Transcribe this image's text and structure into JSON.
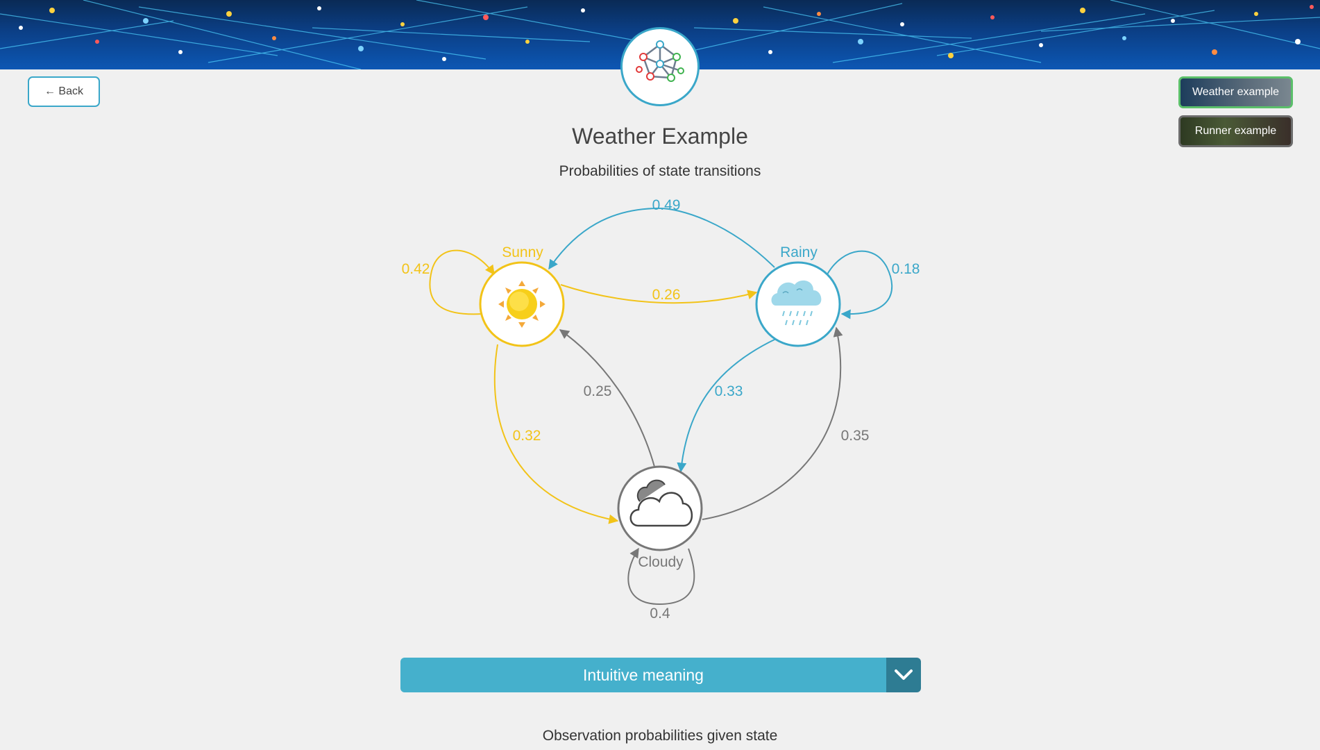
{
  "nav": {
    "back_label": "← Back"
  },
  "examples": {
    "weather_label": "Weather example",
    "runner_label": "Runner example"
  },
  "header": {
    "title": "Weather Example",
    "subtitle": "Probabilities of state transitions"
  },
  "diagram": {
    "states": {
      "sunny": {
        "label": "Sunny",
        "color": "#f2c318",
        "icon": "sun-icon"
      },
      "rainy": {
        "label": "Rainy",
        "color": "#3aa7c9",
        "icon": "rain-cloud-icon"
      },
      "cloudy": {
        "label": "Cloudy",
        "color": "#777777",
        "icon": "cloud-icon"
      }
    },
    "transitions": {
      "sunny_to_sunny": "0.42",
      "sunny_to_rainy": "0.26",
      "sunny_to_cloudy": "0.32",
      "rainy_to_rainy": "0.18",
      "rainy_to_sunny": "0.49",
      "rainy_to_cloudy": "0.33",
      "cloudy_to_cloudy": "0.4",
      "cloudy_to_sunny": "0.25",
      "cloudy_to_rainy": "0.35"
    }
  },
  "accordion": {
    "label": "Intuitive meaning",
    "icon": "chevron-down-icon"
  },
  "section": {
    "observation_heading": "Observation probabilities given state"
  }
}
